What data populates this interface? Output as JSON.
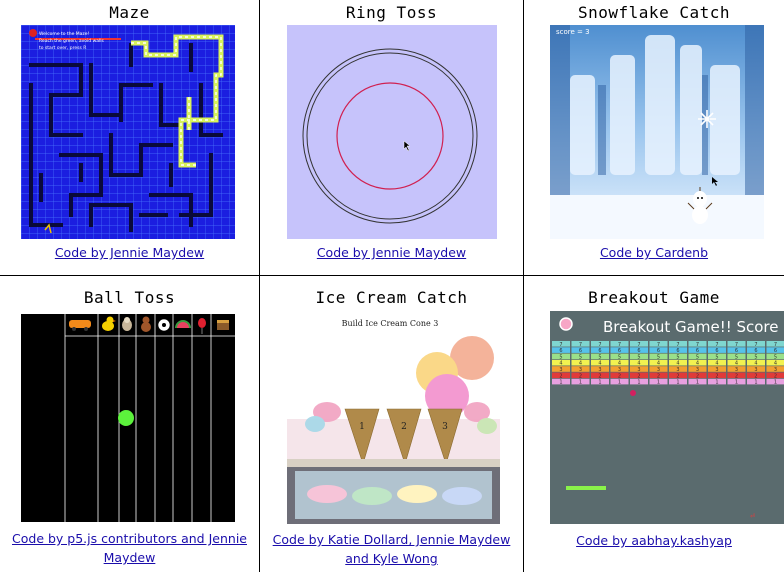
{
  "games": [
    {
      "title": "Maze",
      "credit": "Code by Jennie Maydew",
      "overlay_lines": [
        "Welcome to the Maze!",
        "Reach the green, avoid walls",
        "to start over, press R"
      ]
    },
    {
      "title": "Ring Toss",
      "credit": "Code by Jennie Maydew"
    },
    {
      "title": "Snowflake Catch",
      "credit": "Code by Cardenb",
      "score_text": "score = 3"
    },
    {
      "title": "Ball Toss",
      "credit": "Code by p5.js contributors and Jennie Maydew",
      "icons": [
        "car-icon",
        "duck-icon",
        "dog-icon",
        "teddy-bear-icon",
        "soccer-ball-icon",
        "watermelon-icon",
        "balloon-icon",
        "chest-icon"
      ]
    },
    {
      "title": "Ice Cream Catch",
      "credit": "Code by Katie Dollard, Jennie Maydew and Kyle Wong",
      "heading": "Build Ice Cream Cone 3",
      "cones": [
        "1",
        "2",
        "3"
      ]
    },
    {
      "title": "Breakout Game",
      "credit": "Code by aabhay.kashyap",
      "banner": "Breakout Game!! Score"
    }
  ],
  "colors": {
    "maze_bg": "#1b1ee0",
    "ring_bg": "#c6c3fb",
    "ring_inner": "#d02050",
    "breakout_bg": "#5a6b6e",
    "ball_green": "#5cf23c"
  }
}
